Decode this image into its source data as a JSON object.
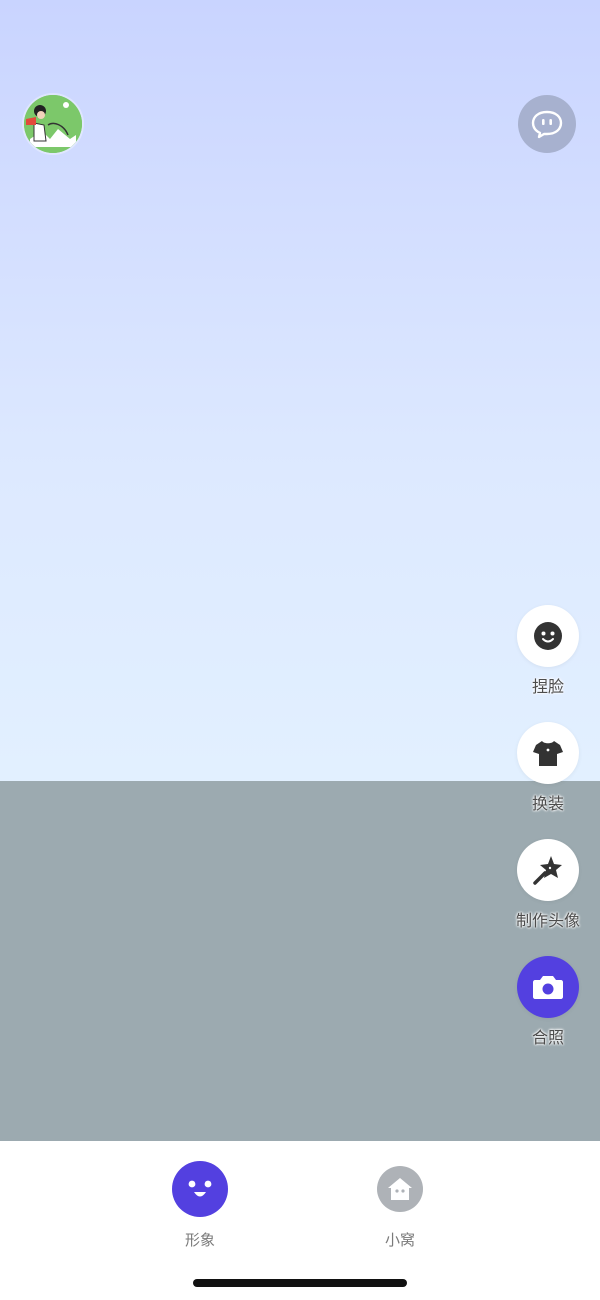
{
  "theme": {
    "accent": "#5340e0",
    "sky_top": "#c9d4ff",
    "sky_bottom": "#e2f0ff",
    "floor": "#9caab0",
    "chat_button_bg": "#a7b1cf",
    "inactive_icon_bg": "#aeb2b7"
  },
  "header": {
    "avatar_icon": "user-avatar",
    "chat_icon": "chat-bubble-icon"
  },
  "actions": [
    {
      "label": "捏脸",
      "icon": "face-icon"
    },
    {
      "label": "换装",
      "icon": "tshirt-icon"
    },
    {
      "label": "制作头像",
      "icon": "magic-wand-star-icon"
    },
    {
      "label": "合照",
      "icon": "camera-icon"
    }
  ],
  "tabs": [
    {
      "label": "形象",
      "icon": "avatar-face-icon",
      "active": true
    },
    {
      "label": "小窝",
      "icon": "home-icon",
      "active": false
    }
  ]
}
